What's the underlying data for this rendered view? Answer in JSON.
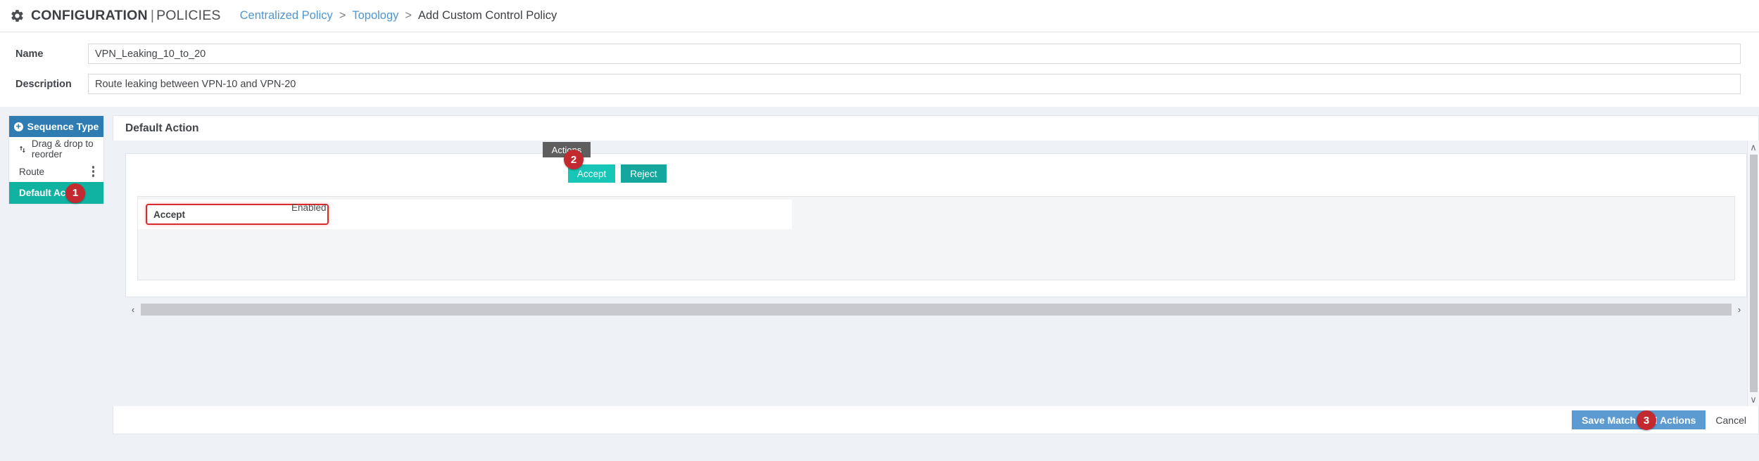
{
  "header": {
    "gear_icon": "gear-icon",
    "app_title": "CONFIGURATION",
    "title_separator": "|",
    "app_subtitle": "POLICIES",
    "breadcrumb": {
      "items": [
        "Centralized Policy",
        "Topology",
        "Add Custom Control Policy"
      ],
      "separator": ">"
    }
  },
  "form": {
    "name": {
      "label": "Name",
      "value": "VPN_Leaking_10_to_20",
      "placeholder": ""
    },
    "description": {
      "label": "Description",
      "value": "Route leaking between VPN-10 and VPN-20",
      "placeholder": ""
    }
  },
  "sidebar": {
    "sequence_type_button": "Sequence Type",
    "plus_icon": "plus-circle-icon",
    "reorder_hint": "Drag & drop to reorder",
    "reorder_icon": "sort-arrows-icon",
    "items": [
      {
        "label": "Route",
        "active": false,
        "menu_icon": "kebab-menu-icon"
      },
      {
        "label": "Default Action",
        "active": true,
        "badge": "1"
      }
    ]
  },
  "panel": {
    "title": "Default Action",
    "actions_tab": "Actions",
    "actions_badge": "2",
    "buttons": [
      {
        "label": "Accept",
        "state": "selected"
      },
      {
        "label": "Reject",
        "state": "normal"
      }
    ],
    "row": {
      "action_label": "Accept",
      "status_label": "Enabled"
    }
  },
  "footer": {
    "save_label": "Save Match And Actions",
    "save_badge": "3",
    "cancel_label": "Cancel"
  },
  "scrollbars": {
    "up_chevron": "∧",
    "down_chevron": "∨",
    "left_chevron": "‹",
    "right_chevron": "›"
  },
  "colors": {
    "accent_blue": "#2e7cb2",
    "active_teal": "#10b2a2",
    "accept_teal": "#17c6b6",
    "reject_teal": "#15a79d",
    "badge_red": "#c22a2f",
    "highlight_red": "#d92b2b",
    "save_blue": "#5b9bd1",
    "link_blue": "#4f96d1",
    "page_bg": "#eef1f6"
  }
}
